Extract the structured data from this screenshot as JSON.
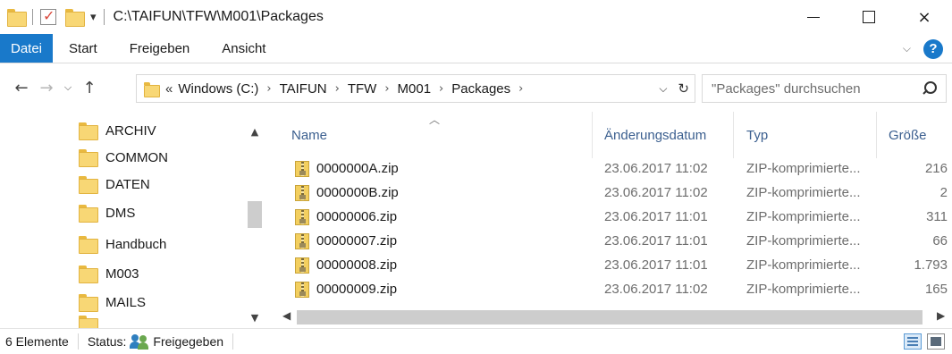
{
  "window": {
    "title": "C:\\TAIFUN\\TFW\\M001\\Packages",
    "min_icon": "minimize-icon",
    "max_icon": "maximize-icon",
    "close_label": "×"
  },
  "ribbon": {
    "tabs": [
      "Datei",
      "Start",
      "Freigeben",
      "Ansicht"
    ]
  },
  "address": {
    "overflow": "«",
    "crumbs": [
      "Windows (C:)",
      "TAIFUN",
      "TFW",
      "M001",
      "Packages"
    ]
  },
  "search": {
    "placeholder": "\"Packages\" durchsuchen"
  },
  "nav_pane": {
    "items": [
      "ARCHIV",
      "COMMON",
      "DATEN",
      "DMS",
      "Handbuch",
      "M003",
      "MAILS"
    ]
  },
  "file_list": {
    "columns": {
      "name": "Name",
      "date": "Änderungsdatum",
      "type": "Typ",
      "size": "Größe"
    },
    "rows": [
      {
        "name": "0000000A.zip",
        "date": "23.06.2017 11:02",
        "type": "ZIP-komprimierte...",
        "size": "216"
      },
      {
        "name": "0000000B.zip",
        "date": "23.06.2017 11:02",
        "type": "ZIP-komprimierte...",
        "size": "2"
      },
      {
        "name": "00000006.zip",
        "date": "23.06.2017 11:01",
        "type": "ZIP-komprimierte...",
        "size": "311"
      },
      {
        "name": "00000007.zip",
        "date": "23.06.2017 11:01",
        "type": "ZIP-komprimierte...",
        "size": "66"
      },
      {
        "name": "00000008.zip",
        "date": "23.06.2017 11:01",
        "type": "ZIP-komprimierte...",
        "size": "1.793"
      },
      {
        "name": "00000009.zip",
        "date": "23.06.2017 11:02",
        "type": "ZIP-komprimierte...",
        "size": "165"
      }
    ]
  },
  "status": {
    "count": "6 Elemente",
    "status_label": "Status:",
    "status_value": "Freigegeben"
  },
  "colors": {
    "accent": "#1979ca",
    "folder": "#f8d775",
    "column_header": "#3b5f8f"
  }
}
